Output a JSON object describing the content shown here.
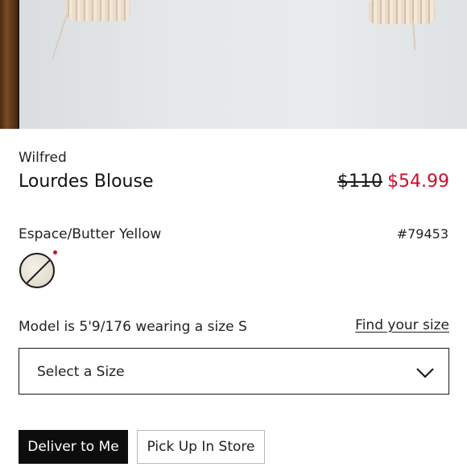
{
  "product": {
    "brand": "Wilfred",
    "name": "Lourdes Blouse",
    "original_price": "$110",
    "sale_price": "$54.99",
    "color_name": "Espace/Butter Yellow",
    "item_number": "#79453"
  },
  "swatch": {
    "icon": "color-swatch-unavailable-icon",
    "indicator_color": "#c8102e"
  },
  "fit": {
    "model_info": "Model is 5'9/176 wearing a size S",
    "find_size_link": "Find your size"
  },
  "size_select": {
    "selected_label": "Select a Size",
    "icon": "chevron-down-icon"
  },
  "fulfillment": {
    "deliver_label": "Deliver to Me",
    "pickup_label": "Pick Up In Store"
  },
  "colors": {
    "sale_red": "#c8102e",
    "primary_button": "#0d0d0d"
  }
}
